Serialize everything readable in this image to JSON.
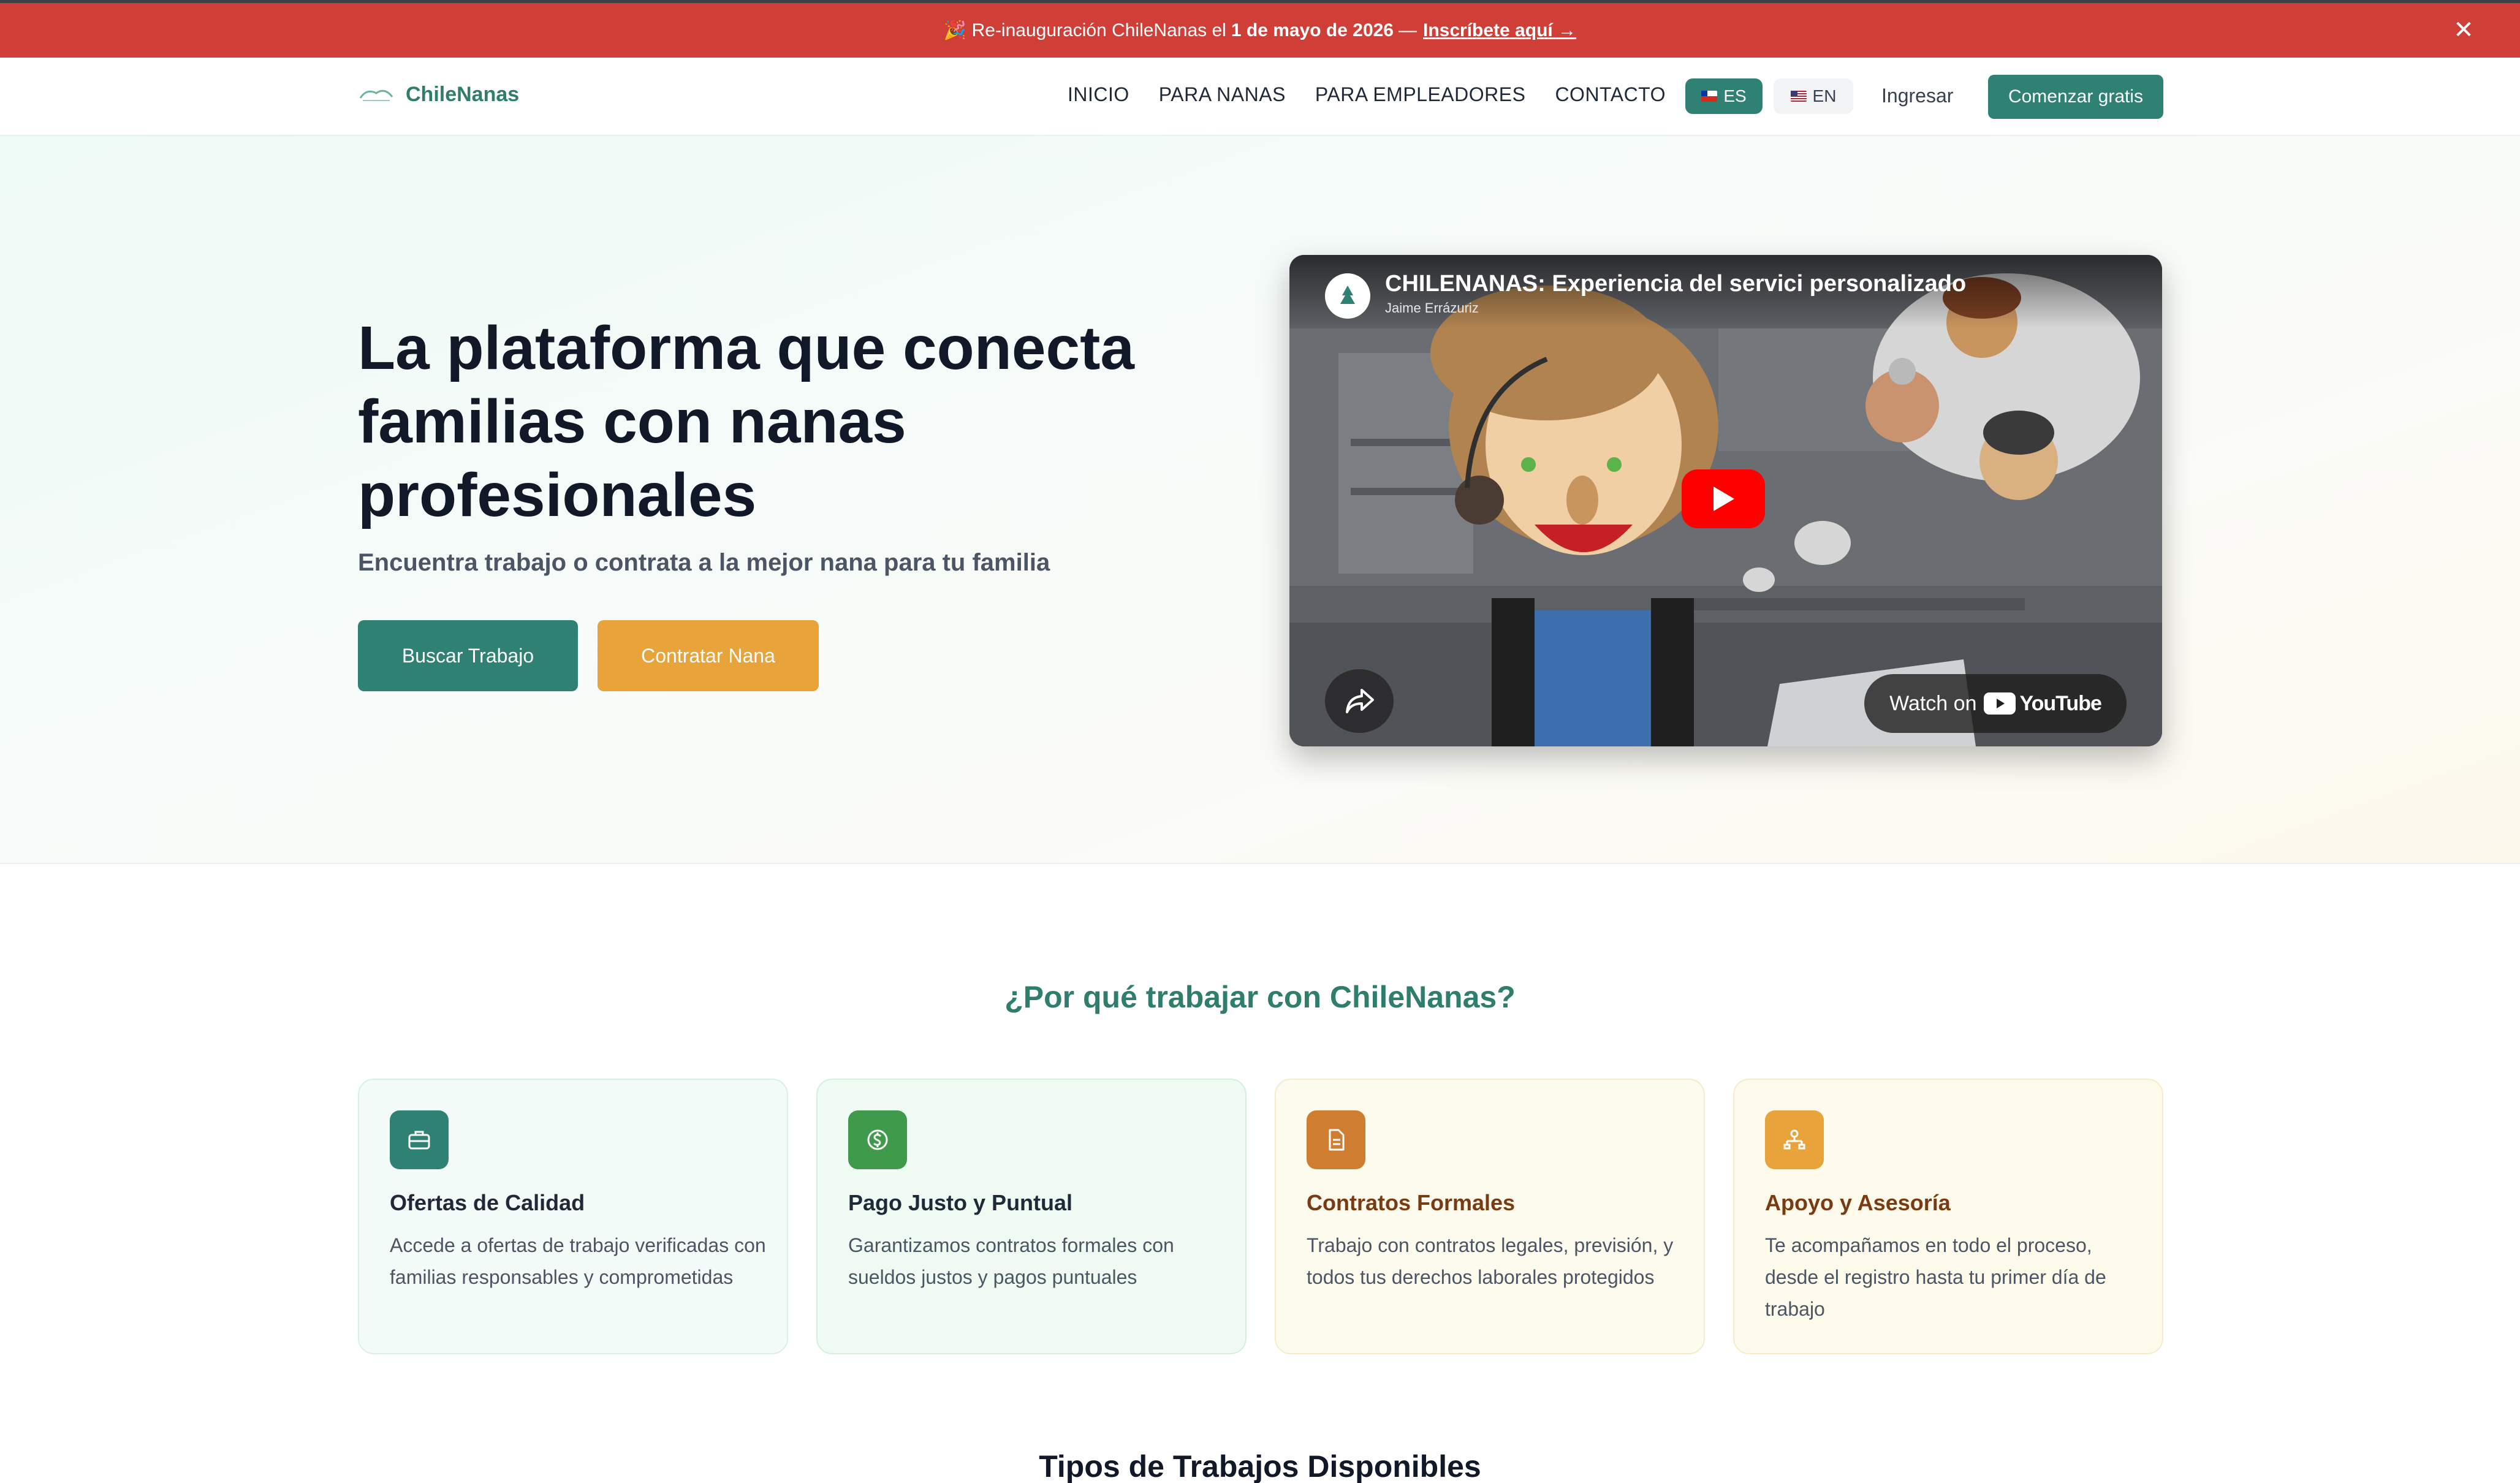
{
  "announcement": {
    "prefix": "🎉 Re-inauguración ChileNanas el",
    "date": "1 de mayo de 2026",
    "separator": "—",
    "link": "Inscríbete aquí →",
    "close": "✕"
  },
  "header": {
    "logo_text": "ChileNanas",
    "nav": [
      "INICIO",
      "PARA NANAS",
      "PARA EMPLEADORES",
      "CONTACTO"
    ],
    "lang_es": "ES",
    "lang_en": "EN",
    "login": "Ingresar",
    "cta": "Comenzar gratis"
  },
  "hero": {
    "title": "La plataforma que conecta familias con nanas profesionales",
    "subtitle": "Encuentra trabajo o contrata a la mejor nana para tu familia",
    "btn_work": "Buscar Trabajo",
    "btn_hire": "Contratar Nana"
  },
  "video": {
    "title": "CHILENANAS: Experiencia del servici personalizado",
    "channel": "Jaime Errázuriz",
    "watch_on": "Watch on",
    "youtube": "YouTube"
  },
  "why": {
    "title": "¿Por qué trabajar con ChileNanas?",
    "cards": [
      {
        "title": "Ofertas de Calidad",
        "text": "Accede a ofertas de trabajo verificadas con familias responsables y comprometidas",
        "icon": "briefcase-icon",
        "color": "#2f8273",
        "title_color": "#1f2937"
      },
      {
        "title": "Pago Justo y Puntual",
        "text": "Garantizamos contratos formales con sueldos justos y pagos puntuales",
        "icon": "dollar-icon",
        "color": "#3f9a4b",
        "title_color": "#1f2937"
      },
      {
        "title": "Contratos Formales",
        "text": "Trabajo con contratos legales, previsión, y todos tus derechos laborales protegidos",
        "icon": "document-icon",
        "color": "#cf7d30",
        "title_color": "#7a3b12"
      },
      {
        "title": "Apoyo y Asesoría",
        "text": "Te acompañamos en todo el proceso, desde el registro hasta tu primer día de trabajo",
        "icon": "support-icon",
        "color": "#e8a33a",
        "title_color": "#7a3b12"
      }
    ]
  },
  "types": {
    "title": "Tipos de Trabajos Disponibles"
  }
}
